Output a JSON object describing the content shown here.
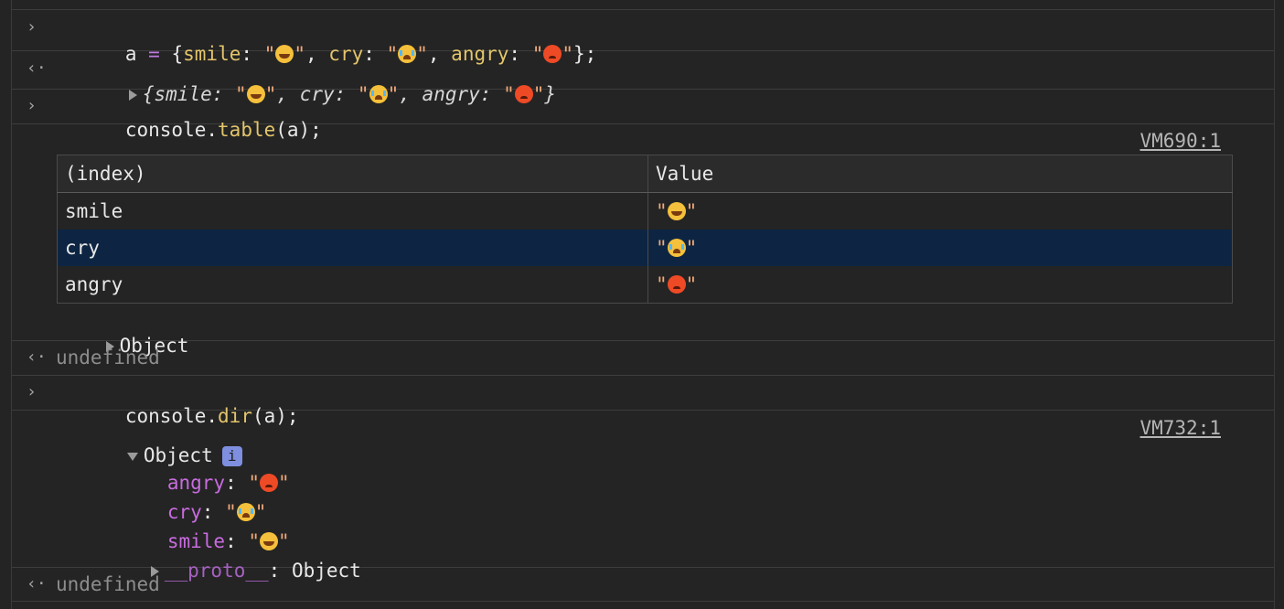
{
  "entries": {
    "e1": {
      "var": "a",
      "eq": "=",
      "open": "{",
      "k1": "smile",
      "k2": "cry",
      "k3": "angry",
      "colon": ":",
      "comma": ",",
      "q": "\"",
      "close": "};"
    },
    "r1": {
      "open": "{",
      "k1": "smile",
      "k2": "cry",
      "k3": "angry",
      "colon": ":",
      "comma": ",",
      "q": "\"",
      "close": "}"
    },
    "e2": {
      "obj": "console",
      "dot": ".",
      "method": "table",
      "args": "(a);"
    },
    "table": {
      "source": "VM690:1",
      "headers": [
        "(index)",
        "Value"
      ],
      "rows": [
        {
          "index": "smile",
          "emoji": "smile"
        },
        {
          "index": "cry",
          "emoji": "cry"
        },
        {
          "index": "angry",
          "emoji": "angry"
        }
      ],
      "quote": "\"",
      "footer": "Object"
    },
    "r2": {
      "text": "undefined"
    },
    "e3": {
      "obj": "console",
      "dot": ".",
      "method": "dir",
      "args": "(a);"
    },
    "dir": {
      "source": "VM732:1",
      "title": "Object",
      "info": "i",
      "props": [
        {
          "key": "angry",
          "emoji": "angry"
        },
        {
          "key": "cry",
          "emoji": "cry"
        },
        {
          "key": "smile",
          "emoji": "smile"
        }
      ],
      "proto_key": "__proto__",
      "proto_val": "Object",
      "colon": ":",
      "quote": "\""
    },
    "r3": {
      "text": "undefined"
    }
  },
  "icons": {
    "input_prompt": "chevron-right-icon",
    "result_prompt": "return-arrow-icon"
  },
  "colors": {
    "background": "#242424",
    "string": "#f0a97a",
    "keyword": "#e3c56b",
    "property": "#c96be0",
    "selected_row": "#0d2543"
  }
}
